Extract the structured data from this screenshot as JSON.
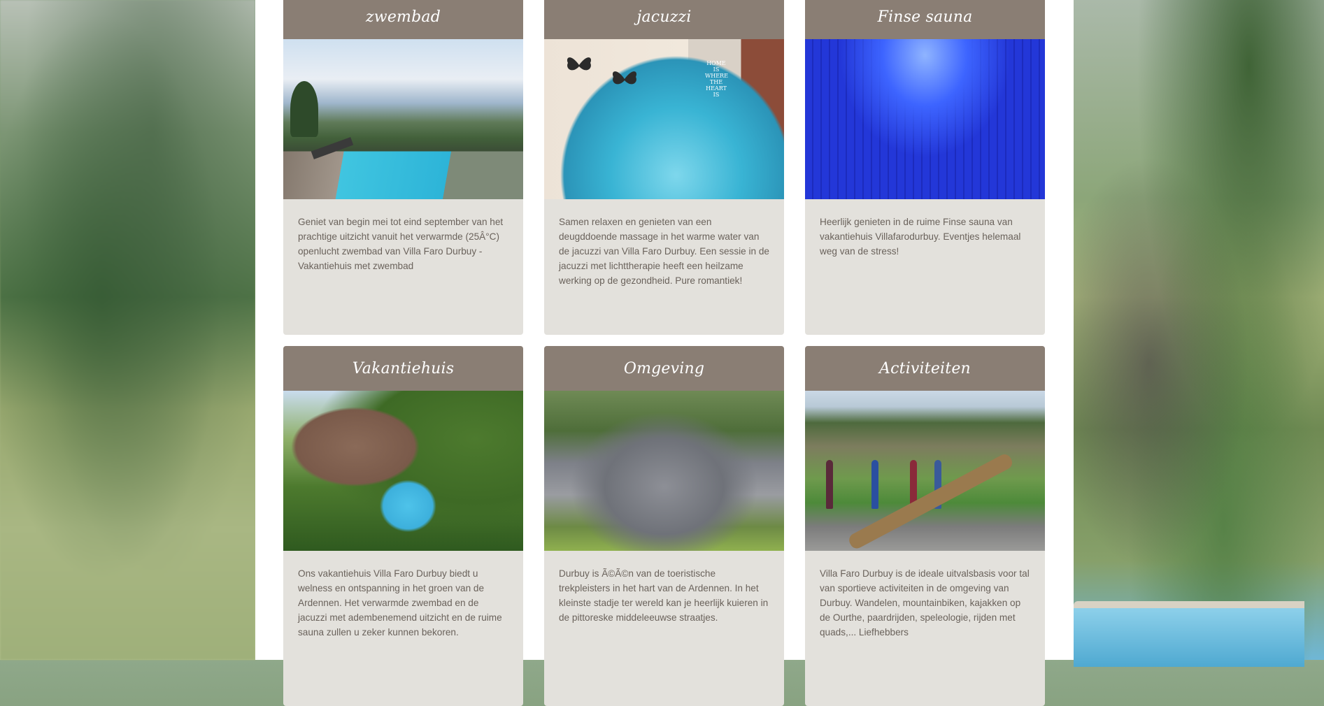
{
  "cards": [
    {
      "title": "zwembad",
      "image_alt": "zwembad photo",
      "text": "Geniet van begin mei tot eind september van het prachtige uitzicht vanuit het verwarmde (25Â°C) openlucht zwembad van Villa Faro Durbuy - Vakantiehuis met zwembad"
    },
    {
      "title": "jacuzzi",
      "image_alt": "jacuzzi photo",
      "image_sign": "HOME IS WHERE THE HEART IS",
      "text": "Samen relaxen en genieten van een deugddoende massage in het warme water van de jacuzzi van Villa Faro Durbuy. Een sessie in de jacuzzi met lichttherapie heeft een heilzame werking op de gezondheid. Pure romantiek!"
    },
    {
      "title": "Finse sauna",
      "image_alt": "sauna photo",
      "text": "Heerlijk genieten in de ruime Finse sauna van vakantiehuis Villafarodurbuy. Eventjes helemaal weg van de stress!"
    },
    {
      "title": "Vakantiehuis",
      "image_alt": "vakantiehuis photo",
      "text": "Ons vakantiehuis Villa Faro Durbuy biedt u welness en ontspanning in het groen van de Ardennen. Het verwarmde zwembad en de jacuzzi met adembenemend uitzicht en de ruime sauna zullen u zeker kunnen bekoren."
    },
    {
      "title": "Omgeving",
      "image_alt": "omgeving photo",
      "text": "Durbuy is Ã©Ã©n van de toeristische trekpleisters in het hart van de Ardennen. In het kleinste stadje ter wereld kan je heerlijk kuieren in de pittoreske middeleeuwse straatjes."
    },
    {
      "title": "Activiteiten",
      "image_alt": "activiteiten photo",
      "text": "Villa Faro Durbuy is de ideale uitvalsbasis voor tal van sportieve activiteiten in de omgeving van Durbuy. Wandelen, mountainbiken, kajakken op de Ourthe, paardrijden, speleologie, rijden met quads,... Liefhebbers"
    }
  ],
  "colors": {
    "card_header": "#8a7e74",
    "card_body": "#e3e1dc",
    "text": "#6a625b"
  }
}
